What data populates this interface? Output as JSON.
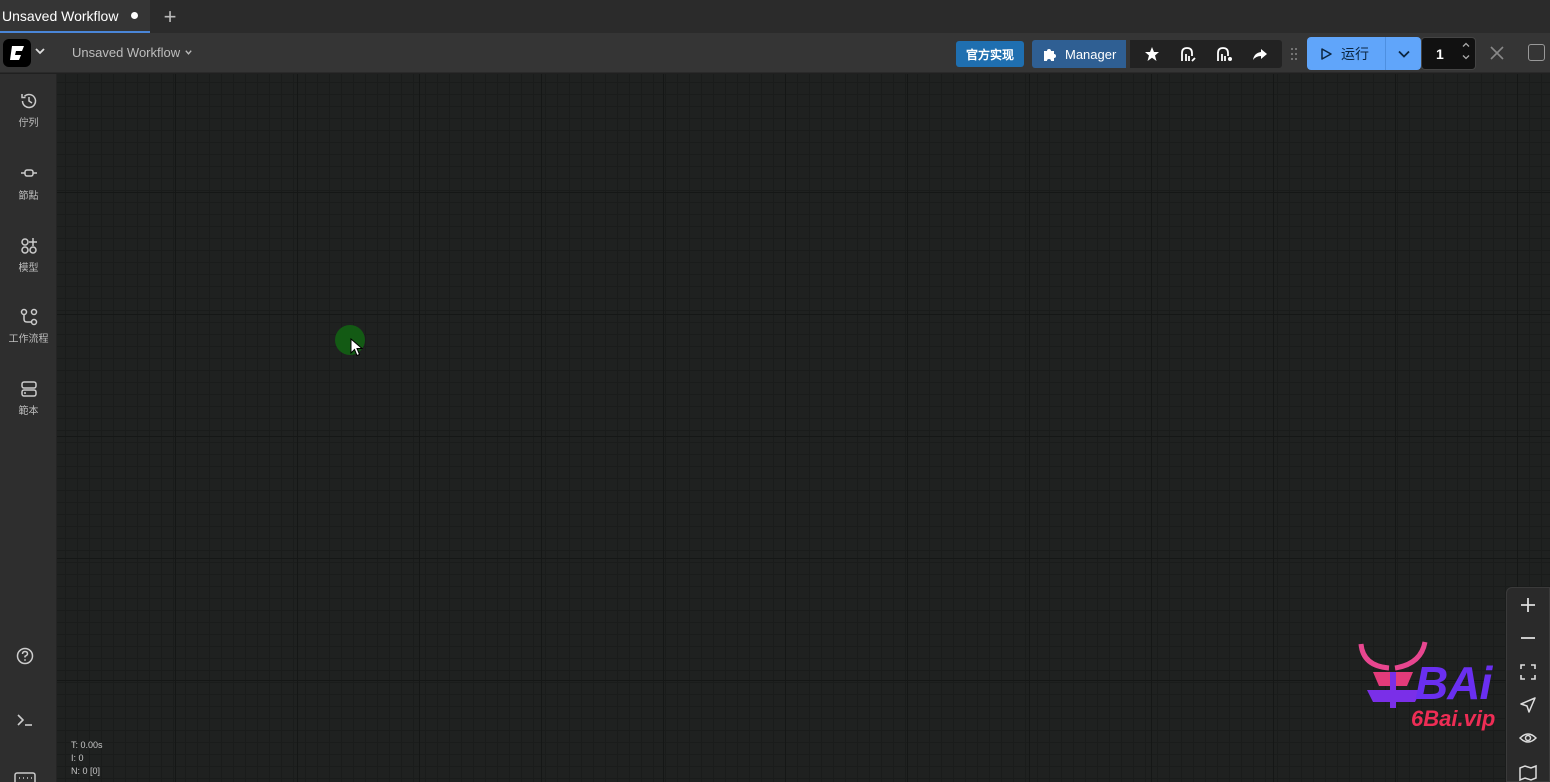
{
  "tabs": [
    {
      "title": "Unsaved Workflow",
      "unsaved": true
    }
  ],
  "menubar": {
    "workflow_name": "Unsaved Workflow",
    "official_label": "官方实现",
    "manager_label": "Manager",
    "run_label": "运行",
    "batch_count": "1"
  },
  "sidebar": {
    "items": [
      {
        "label": "佇列",
        "icon": "history-icon"
      },
      {
        "label": "節點",
        "icon": "node-icon"
      },
      {
        "label": "模型",
        "icon": "models-icon"
      },
      {
        "label": "工作流程",
        "icon": "workflow-icon"
      },
      {
        "label": "範本",
        "icon": "template-icon"
      }
    ]
  },
  "stats": {
    "t": "T: 0.00s",
    "i": "I: 0",
    "n": "N: 0 [0]"
  },
  "watermark": {
    "main": "BAi",
    "sub": "6Bai.vip"
  },
  "colors": {
    "accent": "#60a5fa",
    "official": "#1f6fb0",
    "manager": "#2f5f93",
    "canvas": "#1f2120"
  }
}
